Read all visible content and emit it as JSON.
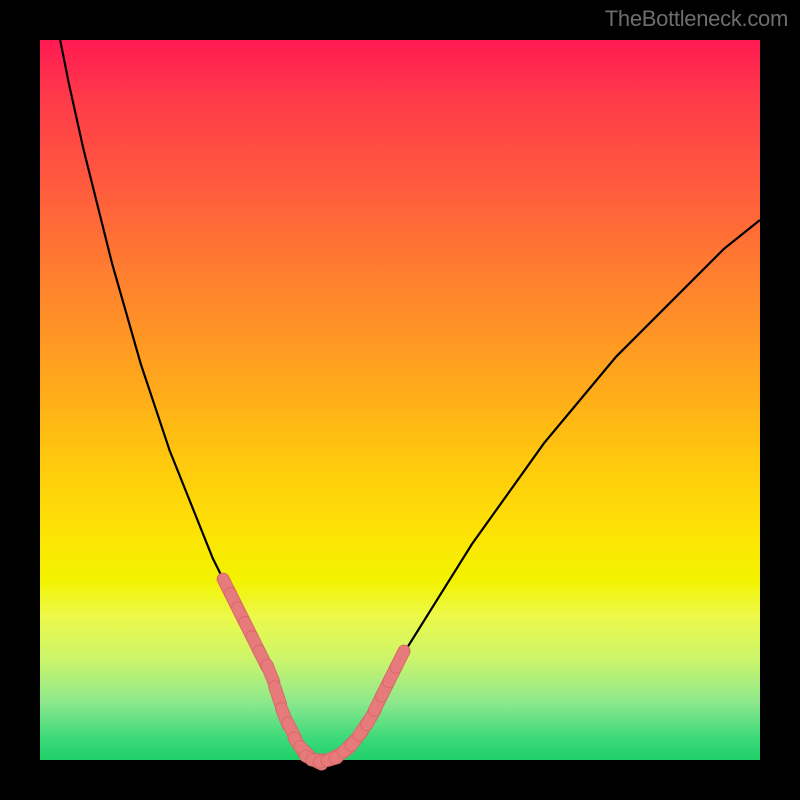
{
  "watermark": "TheBottleneck.com",
  "colors": {
    "frame": "#000000",
    "curve_stroke": "#000000",
    "marker_fill": "#e77a7a",
    "marker_stroke": "#d86a6a",
    "gradient_top": "#ff1a52",
    "gradient_bottom": "#1fd16a"
  },
  "chart_data": {
    "type": "line",
    "title": "",
    "xlabel": "",
    "ylabel": "",
    "xlim": [
      0,
      100
    ],
    "ylim": [
      0,
      100
    ],
    "grid": false,
    "legend": false,
    "x": [
      0,
      2,
      4,
      6,
      8,
      10,
      12,
      14,
      16,
      18,
      20,
      22,
      24,
      26,
      28,
      30,
      32,
      33,
      34,
      35,
      36,
      37,
      38,
      40,
      42,
      44,
      46,
      48,
      50,
      55,
      60,
      65,
      70,
      75,
      80,
      85,
      90,
      95,
      100
    ],
    "y": [
      115,
      104,
      94,
      85,
      77,
      69,
      62,
      55,
      49,
      43,
      38,
      33,
      28,
      24,
      20,
      16,
      12,
      9,
      6,
      4,
      2,
      1,
      0,
      0,
      1,
      3,
      6,
      10,
      14,
      22,
      30,
      37,
      44,
      50,
      56,
      61,
      66,
      71,
      75
    ],
    "markers": {
      "x": [
        26,
        27,
        28,
        29,
        30,
        31,
        32,
        33,
        34,
        35,
        36,
        37,
        38,
        39,
        40,
        41,
        42,
        43,
        44,
        45,
        46,
        47,
        48,
        49,
        50
      ],
      "y": [
        24,
        22,
        20,
        18,
        16,
        14,
        12,
        9,
        6,
        4,
        2,
        1,
        0,
        0,
        0,
        0.5,
        1,
        2,
        3,
        4.5,
        6,
        8,
        10,
        12,
        14
      ]
    }
  }
}
